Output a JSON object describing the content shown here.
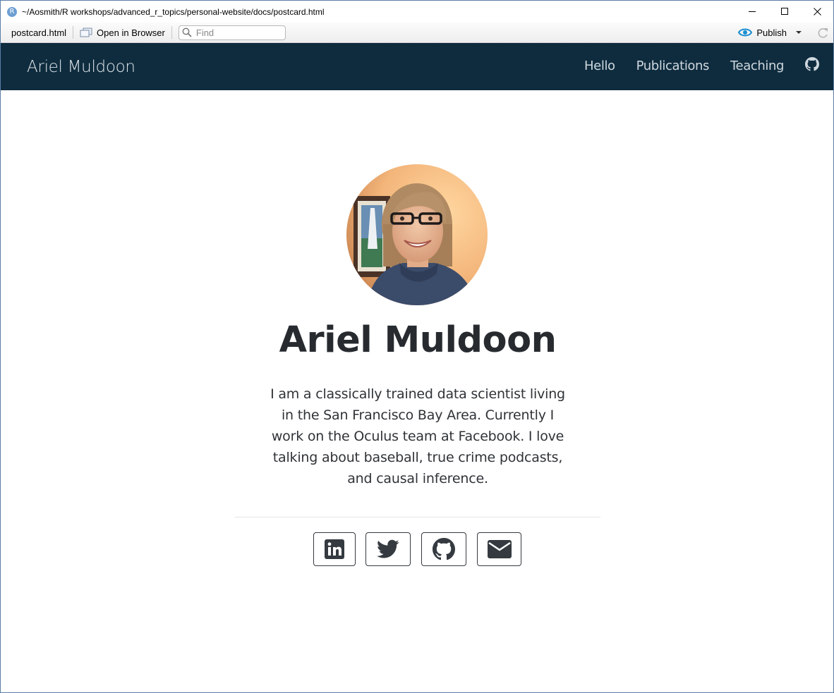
{
  "window": {
    "title": "~/Aosmith/R workshops/advanced_r_topics/personal-website/docs/postcard.html",
    "app_icon_letter": "R"
  },
  "toolbar": {
    "file_name": "postcard.html",
    "open_in_browser_label": "Open in Browser",
    "find_placeholder": "Find",
    "publish_label": "Publish"
  },
  "navbar": {
    "brand": "Ariel Muldoon",
    "links": [
      "Hello",
      "Publications",
      "Teaching"
    ]
  },
  "profile": {
    "name": "Ariel Muldoon",
    "bio": "I am a classically trained data scientist living in the San Francisco Bay Area. Currently I work on the Oculus team at Facebook. I love talking about baseball, true crime podcasts, and causal inference."
  },
  "social_icons": [
    "linkedin-icon",
    "twitter-icon",
    "github-icon",
    "email-icon"
  ],
  "colors": {
    "navbar_bg": "#0f2c3f",
    "text_dark": "#272b30",
    "publish_accent": "#1a8ed1"
  }
}
